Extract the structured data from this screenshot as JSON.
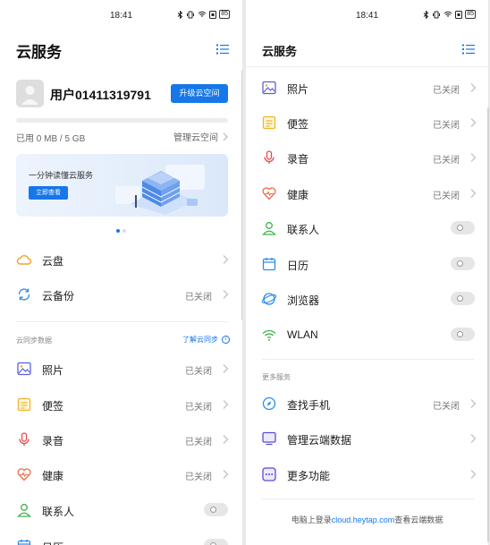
{
  "status_bar": {
    "time": "18:41",
    "battery": "85"
  },
  "colors": {
    "accent": "#1677e8",
    "background": "#ffffff",
    "toggle_off": "#e6e6e6"
  },
  "left": {
    "title": "云服务",
    "user": {
      "name": "用户01411319791",
      "upgrade_label": "升级云空间"
    },
    "storage": {
      "usage_text": "已用 0 MB / 5 GB",
      "manage_label": "管理云空间",
      "used_fraction": 0.0
    },
    "banner": {
      "text": "一分钟读懂云服务",
      "button_label": "立即查看"
    },
    "carousel": {
      "count": 2,
      "active": 1
    },
    "services": [
      {
        "label": "云盘",
        "status": "",
        "icon": "cloud-icon"
      },
      {
        "label": "云备份",
        "status": "已关闭",
        "icon": "backup-icon"
      }
    ],
    "sync_section_label": "云同步数据",
    "learn_link": "了解云同步",
    "sync_items": [
      {
        "label": "照片",
        "status": "已关闭",
        "control": "chevron",
        "icon": "photo-icon"
      },
      {
        "label": "便签",
        "status": "已关闭",
        "control": "chevron",
        "icon": "note-icon"
      },
      {
        "label": "录音",
        "status": "已关闭",
        "control": "chevron",
        "icon": "microphone-icon"
      },
      {
        "label": "健康",
        "status": "已关闭",
        "control": "chevron",
        "icon": "heart-icon"
      },
      {
        "label": "联系人",
        "status": "",
        "control": "toggle",
        "on": false,
        "icon": "contact-icon"
      },
      {
        "label": "日历",
        "status": "",
        "control": "toggle",
        "on": false,
        "icon": "calendar-icon"
      }
    ]
  },
  "right": {
    "title": "云服务",
    "sync_items": [
      {
        "label": "照片",
        "status": "已关闭",
        "control": "chevron",
        "icon": "photo-icon"
      },
      {
        "label": "便签",
        "status": "已关闭",
        "control": "chevron",
        "icon": "note-icon"
      },
      {
        "label": "录音",
        "status": "已关闭",
        "control": "chevron",
        "icon": "microphone-icon"
      },
      {
        "label": "健康",
        "status": "已关闭",
        "control": "chevron",
        "icon": "heart-icon"
      },
      {
        "label": "联系人",
        "status": "",
        "control": "toggle",
        "on": false,
        "icon": "contact-icon"
      },
      {
        "label": "日历",
        "status": "",
        "control": "toggle",
        "on": false,
        "icon": "calendar-icon"
      },
      {
        "label": "浏览器",
        "status": "",
        "control": "toggle",
        "on": false,
        "icon": "browser-icon"
      },
      {
        "label": "WLAN",
        "status": "",
        "control": "toggle",
        "on": false,
        "icon": "wifi-icon"
      }
    ],
    "more_section_label": "更多服务",
    "more_items": [
      {
        "label": "查找手机",
        "status": "已关闭",
        "icon": "find-phone-icon"
      },
      {
        "label": "管理云端数据",
        "status": "",
        "icon": "monitor-icon"
      },
      {
        "label": "更多功能",
        "status": "",
        "icon": "more-icon"
      }
    ],
    "footer": {
      "prefix": "电脑上登录",
      "link": "cloud.heytap.com",
      "suffix": "查看云端数据"
    }
  }
}
